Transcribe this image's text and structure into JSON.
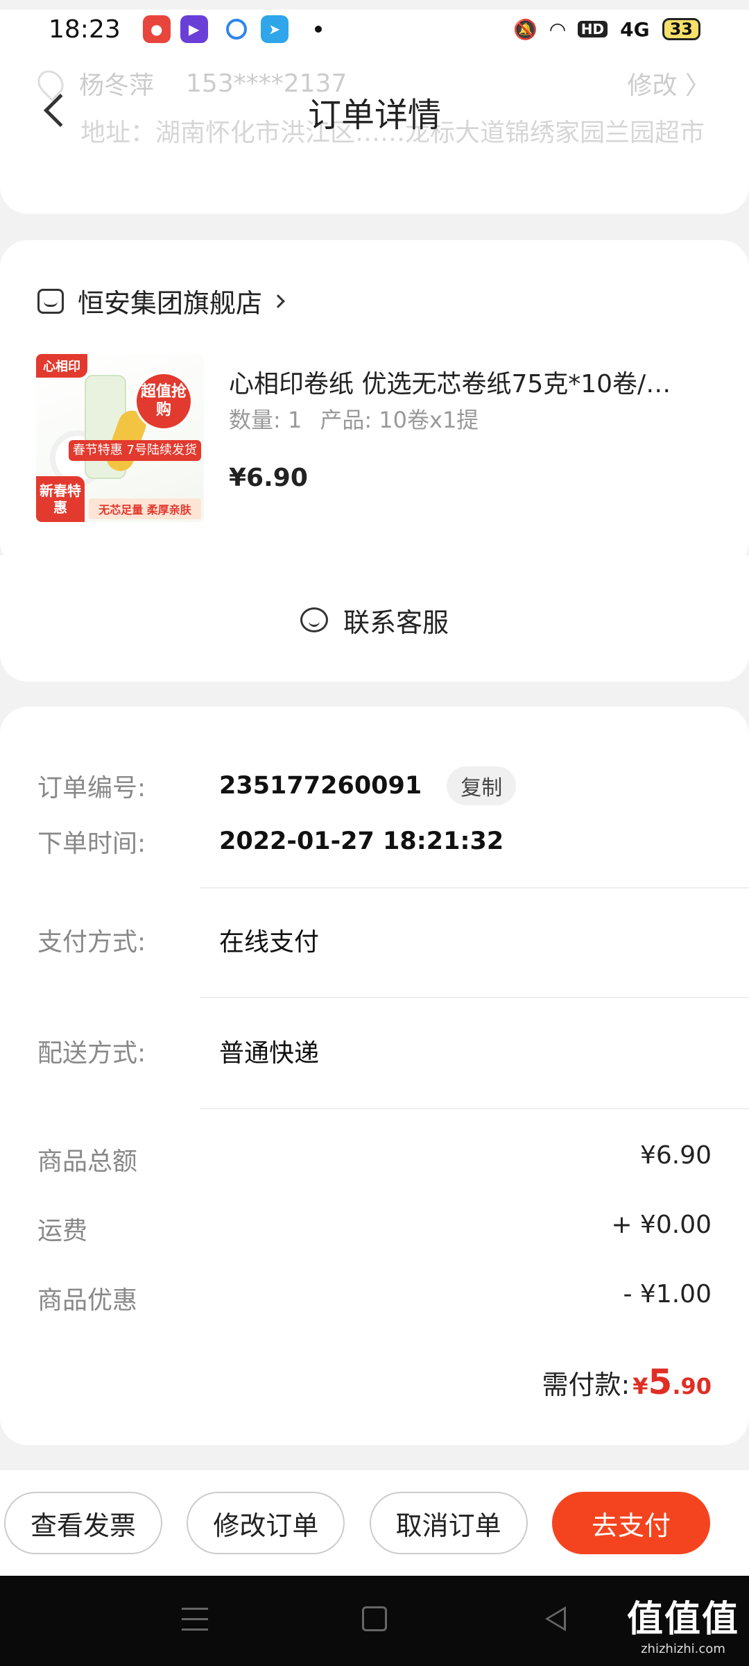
{
  "status_bar": {
    "time": "18:23",
    "network": "4G",
    "hd": "HD",
    "battery": "33"
  },
  "header": {
    "title": "订单详情",
    "back_icon": "chevron-left-icon"
  },
  "address": {
    "name": "杨冬萍",
    "phone": "153****2137",
    "edit_label": "修改 〉",
    "text": "地址：湖南怀化市洪江区……龙标大道锦绣家园兰园超市"
  },
  "store": {
    "name": "恒安集团旗舰店",
    "product": {
      "name": "心相印卷纸 优选无芯卷纸75克*10卷/…",
      "quantity": "数量: 1",
      "spec": "产品: 10卷x1提",
      "price": "¥6.90",
      "image_tags": {
        "brand": "心相印",
        "circle": "超值抢购",
        "spring": "春节特惠 7号陆续发货",
        "newyear": "新春特惠",
        "bottom": "无芯足量 柔厚亲肤"
      }
    }
  },
  "customer_service": {
    "label": "联系客服"
  },
  "order_info": {
    "order_no_label": "订单编号:",
    "order_no": "235177260091",
    "copy_label": "复制",
    "time_label": "下单时间:",
    "time": "2022-01-27 18:21:32",
    "payment_label": "支付方式:",
    "payment": "在线支付",
    "delivery_label": "配送方式:",
    "delivery": "普通快递",
    "goods_total_label": "商品总额",
    "goods_total": "¥6.90",
    "shipping_label": "运费",
    "shipping": "+ ¥0.00",
    "discount_label": "商品优惠",
    "discount": "- ¥1.00",
    "pay_label": "需付款:",
    "pay_currency": "¥",
    "pay_int": "5",
    "pay_dec": ".90"
  },
  "actions": {
    "invoice": "查看发票",
    "modify": "修改订单",
    "cancel": "取消订单",
    "pay": "去支付"
  },
  "watermark": {
    "big": "值值值",
    "small": "zhizhizhi.com"
  },
  "colors": {
    "accent": "#f4441f",
    "price_red": "#e02e24",
    "background": "#f2f2f2"
  }
}
